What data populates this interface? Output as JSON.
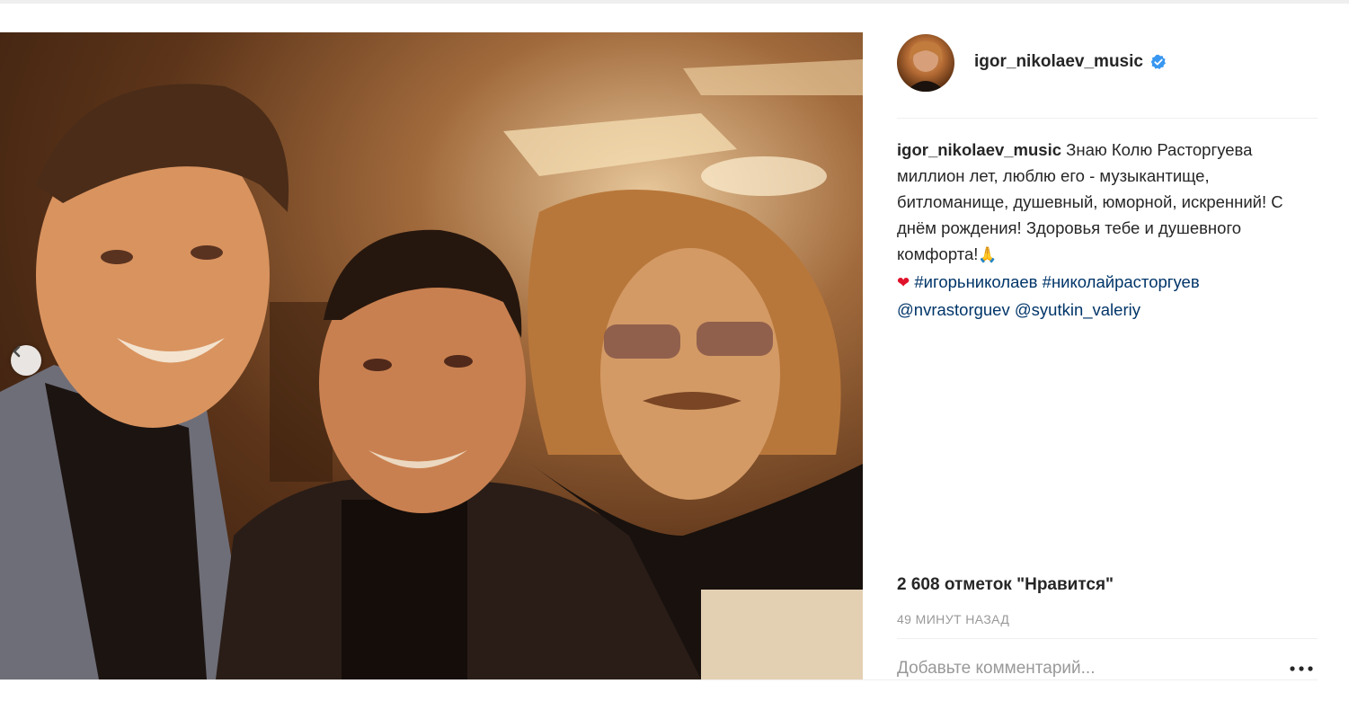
{
  "post": {
    "author": {
      "username": "igor_nikolaev_music",
      "verified": true,
      "avatar_icon": "user-avatar"
    },
    "caption": {
      "username": "igor_nikolaev_music",
      "text": "Знаю Колю Расторгуева миллион лет, люблю его - музыкантище, битломанище, душевный, юморной, искренний! С днём рождения! Здоровья тебе и душевного комфорта!",
      "pray_emoji": "🙏",
      "heart_emoji": "❤",
      "hashtags": [
        "#игорьниколаев",
        "#николайрасторгуев"
      ],
      "mentions": [
        "@nvrastorguev",
        "@syutkin_valeriy"
      ]
    },
    "likes_text": "2 608 отметок \"Нравится\"",
    "timestamp": "49 МИНУТ НАЗАД",
    "comment": {
      "placeholder": "Добавьте комментарий...",
      "value": ""
    },
    "more_options_icon": "ellipsis-icon",
    "carousel_prev_icon": "chevron-left-icon"
  },
  "colors": {
    "link": "#003569",
    "text": "#262626",
    "muted": "#999999",
    "verified": "#3897f0",
    "border": "#efefef"
  }
}
